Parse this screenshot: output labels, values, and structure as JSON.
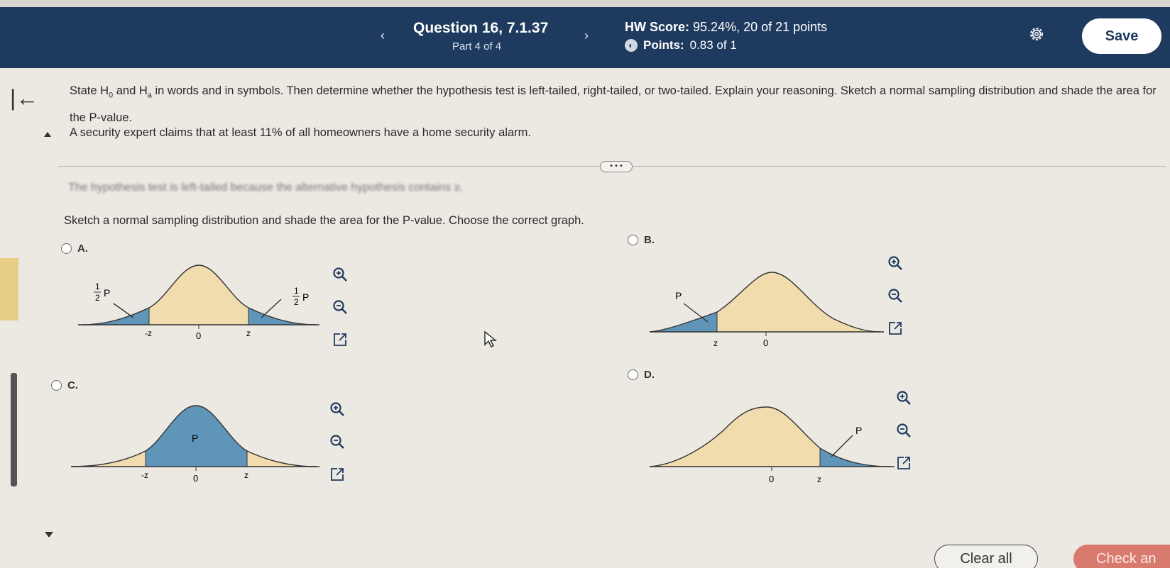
{
  "header": {
    "question_title": "Question 16, 7.1.37",
    "part": "Part 4 of 4",
    "prev_label": "‹",
    "next_label": "›",
    "hw_score_label": "HW Score:",
    "hw_score_value": "95.24%, 20 of 21 points",
    "points_label": "Points:",
    "points_value": "0.83 of 1",
    "save_label": "Save"
  },
  "question": {
    "instruction_p1": "State H",
    "instruction_sub0": "0",
    "instruction_p2": " and H",
    "instruction_suba": "a",
    "instruction_p3": " in words and in symbols. Then determine whether the hypothesis test is left-tailed, right-tailed, or two-tailed. Explain your reasoning. Sketch a normal sampling distribution and shade the area for the P-value.",
    "claim": "A security expert claims that at least 11% of all homeowners have a home security alarm.",
    "ellipsis": "• • •",
    "blurred_text": "The hypothesis test is  left-tailed  because the alternative hypothesis contains  ≥.",
    "sketch_prompt": "Sketch a normal sampling distribution and shade the area for the P-value. Choose the correct graph."
  },
  "options": [
    {
      "letter": "A.",
      "labels": {
        "left_tail": "P",
        "right_tail": "P",
        "half": "1",
        "half_den": "2",
        "neg_z": "-z",
        "zero": "0",
        "z": "z"
      }
    },
    {
      "letter": "B.",
      "labels": {
        "tail": "P",
        "z": "z",
        "zero": "0"
      }
    },
    {
      "letter": "C.",
      "labels": {
        "center": "P",
        "neg_z": "-z",
        "zero": "0",
        "z": "z"
      }
    },
    {
      "letter": "D.",
      "labels": {
        "tail": "P",
        "zero": "0",
        "z": "z"
      }
    }
  ],
  "icons": [
    "back-arrow-icon",
    "gear-icon",
    "zoom-in-icon",
    "zoom-out-icon",
    "expand-icon",
    "mouse-cursor-icon"
  ],
  "colors": {
    "header_bg": "#1e3a5f",
    "fill_tan": "#f1dcae",
    "fill_blue": "#5f95b8",
    "check_btn": "#d97a6e"
  },
  "footer": {
    "clear_label": "Clear all",
    "check_label": "Check an"
  }
}
